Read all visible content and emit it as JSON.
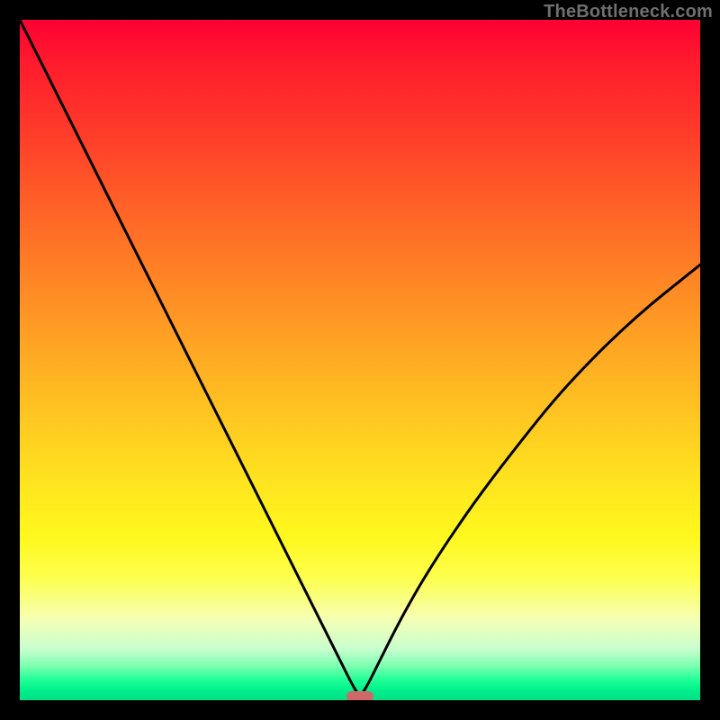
{
  "watermark": "TheBottleneck.com",
  "colors": {
    "background": "#000000",
    "curve_stroke": "#000000",
    "marker_fill": "#d06868"
  },
  "chart_data": {
    "type": "line",
    "title": "",
    "xlabel": "",
    "ylabel": "",
    "xlim": [
      0,
      100
    ],
    "ylim": [
      0,
      100
    ],
    "grid": false,
    "series": [
      {
        "name": "bottleneck-curve",
        "x": [
          0,
          4,
          8,
          12,
          16,
          20,
          24,
          28,
          32,
          36,
          40,
          44,
          47,
          49,
          50,
          51,
          53,
          56,
          60,
          66,
          72,
          80,
          90,
          100
        ],
        "y": [
          100,
          92,
          84,
          76,
          68,
          60,
          52,
          44,
          36,
          28,
          20,
          12,
          6,
          2,
          0.5,
          2,
          6,
          12,
          19,
          28,
          36,
          46,
          56,
          64
        ]
      }
    ],
    "marker": {
      "x": 50,
      "y": 0.5
    },
    "gradient_stops": [
      {
        "pct": 0,
        "color": "#ff0033"
      },
      {
        "pct": 17,
        "color": "#ff3d2a"
      },
      {
        "pct": 43,
        "color": "#ff9524"
      },
      {
        "pct": 68,
        "color": "#ffe41f"
      },
      {
        "pct": 88,
        "color": "#f6ffb3"
      },
      {
        "pct": 95,
        "color": "#7bffb0"
      },
      {
        "pct": 100,
        "color": "#00e085"
      }
    ]
  }
}
